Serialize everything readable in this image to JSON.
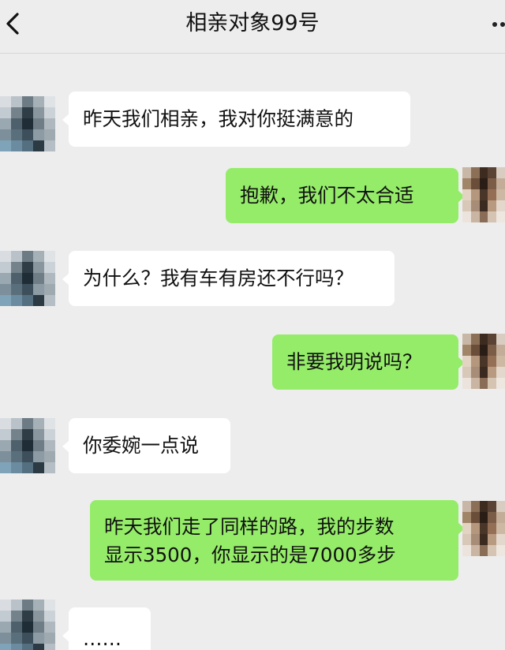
{
  "header": {
    "title": "相亲对象99号",
    "back_icon": "chevron-left-icon",
    "more_icon": "more-dots-icon"
  },
  "colors": {
    "background": "#ededed",
    "incoming_bubble": "#ffffff",
    "outgoing_bubble": "#95ec69"
  },
  "messages": [
    {
      "side": "left",
      "lines": [
        "昨天我们相亲，我对你挺满意的"
      ]
    },
    {
      "side": "right",
      "lines": [
        "抱歉，我们不太合适"
      ]
    },
    {
      "side": "left",
      "lines": [
        "为什么？我有车有房还不行吗？"
      ]
    },
    {
      "side": "right",
      "lines": [
        "非要我明说吗？"
      ]
    },
    {
      "side": "left",
      "lines": [
        "你委婉一点说"
      ]
    },
    {
      "side": "right",
      "lines": [
        "昨天我们走了同样的路，我的步数",
        "显示3500，你显示的是7000多步"
      ]
    },
    {
      "side": "left",
      "lines": [
        "……"
      ]
    }
  ]
}
